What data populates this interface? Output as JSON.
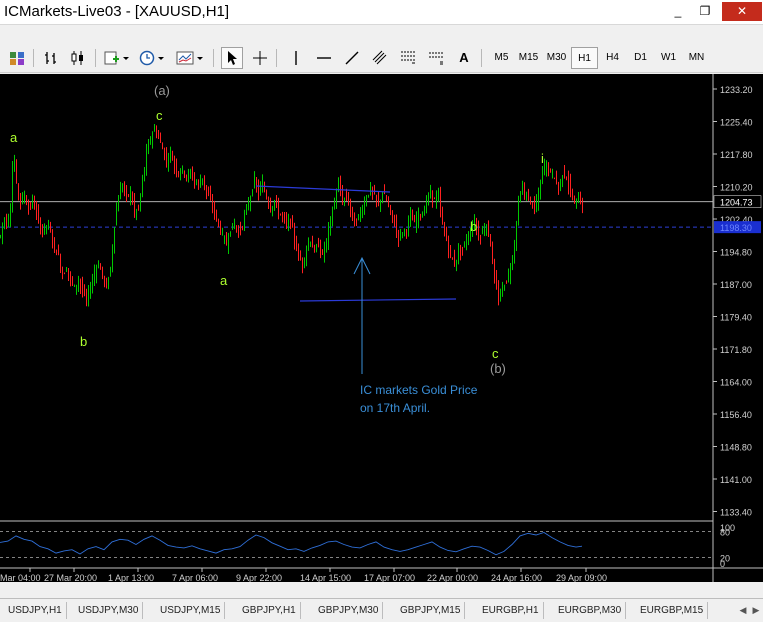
{
  "window": {
    "title": "ICMarkets-Live03 - [XAUUSD,H1]",
    "minimize": "_",
    "restore": "❐",
    "close": "✕"
  },
  "toolbar": {
    "timeframes": [
      "M5",
      "M15",
      "M30",
      "H1",
      "H4",
      "D1",
      "W1",
      "MN"
    ],
    "active_timeframe": "H1",
    "text_tool": "A"
  },
  "chart": {
    "background": "#000000",
    "bull_color": "#00c800",
    "bear_color": "#ff2020",
    "wave_label_color": "#adff2f",
    "major_label_color": "#9a9a9a",
    "channel_color": "#2b3bd8",
    "arrow_color": "#3a8fd8",
    "price_axis_labels": [
      "1233.20",
      "1225.40",
      "1217.80",
      "1210.20",
      "1202.40",
      "1194.80",
      "1187.00",
      "1179.40",
      "1171.80",
      "1164.00",
      "1156.40",
      "1148.80",
      "1141.00",
      "1133.40"
    ],
    "current_price_label": "1204.73",
    "bid_line_label": "1198.30",
    "date_labels": [
      "Mar 04:00",
      "27 Mar 20:00",
      "1 Apr 13:00",
      "7 Apr 06:00",
      "9 Apr 22:00",
      "14 Apr 15:00",
      "17 Apr 07:00",
      "22 Apr 00:00",
      "24 Apr 16:00",
      "29 Apr 09:00"
    ],
    "wave_labels": {
      "a1": "a",
      "b1": "b",
      "c1": "c",
      "a2": "a",
      "b2": "b",
      "c2": "c",
      "i": "i",
      "major_a": "(a)",
      "major_b": "(b)"
    },
    "annotation": {
      "line1": "IC markets Gold Price",
      "line2": "on 17th April."
    },
    "chart_data": {
      "type": "candlestick",
      "symbol": "XAUUSD",
      "timeframe": "H1",
      "ylim": [
        1133.4,
        1233.2
      ],
      "current_price": 1204.73,
      "bid_price": 1198.3,
      "path": [
        [
          0,
          1196
        ],
        [
          3,
          1201
        ],
        [
          6,
          1199
        ],
        [
          10,
          1203
        ],
        [
          13,
          1218
        ],
        [
          16,
          1209
        ],
        [
          20,
          1205
        ],
        [
          24,
          1206
        ],
        [
          28,
          1203
        ],
        [
          32,
          1205
        ],
        [
          37,
          1201
        ],
        [
          41,
          1197
        ],
        [
          45,
          1199
        ],
        [
          49,
          1198
        ],
        [
          54,
          1193
        ],
        [
          58,
          1191
        ],
        [
          62,
          1186
        ],
        [
          66,
          1188
        ],
        [
          70,
          1185
        ],
        [
          74,
          1183
        ],
        [
          78,
          1185
        ],
        [
          82,
          1182
        ],
        [
          86,
          1180
        ],
        [
          90,
          1183
        ],
        [
          94,
          1187
        ],
        [
          98,
          1189
        ],
        [
          102,
          1186
        ],
        [
          106,
          1183
        ],
        [
          110,
          1188
        ],
        [
          114,
          1199
        ],
        [
          118,
          1206
        ],
        [
          122,
          1209
        ],
        [
          126,
          1206
        ],
        [
          130,
          1207
        ],
        [
          134,
          1202
        ],
        [
          138,
          1203
        ],
        [
          142,
          1210
        ],
        [
          146,
          1217
        ],
        [
          150,
          1221
        ],
        [
          154,
          1223
        ],
        [
          158,
          1221
        ],
        [
          162,
          1218
        ],
        [
          166,
          1215
        ],
        [
          170,
          1217
        ],
        [
          174,
          1214
        ],
        [
          178,
          1212
        ],
        [
          182,
          1213
        ],
        [
          186,
          1211
        ],
        [
          190,
          1212
        ],
        [
          194,
          1210
        ],
        [
          198,
          1209
        ],
        [
          202,
          1211
        ],
        [
          206,
          1207
        ],
        [
          210,
          1205
        ],
        [
          214,
          1202
        ],
        [
          218,
          1199
        ],
        [
          222,
          1196
        ],
        [
          226,
          1194
        ],
        [
          230,
          1198
        ],
        [
          234,
          1199
        ],
        [
          238,
          1197
        ],
        [
          242,
          1199
        ],
        [
          246,
          1203
        ],
        [
          250,
          1206
        ],
        [
          254,
          1210
        ],
        [
          258,
          1207
        ],
        [
          262,
          1209
        ],
        [
          266,
          1206
        ],
        [
          270,
          1203
        ],
        [
          274,
          1205
        ],
        [
          278,
          1202
        ],
        [
          282,
          1201
        ],
        [
          286,
          1199
        ],
        [
          290,
          1200
        ],
        [
          294,
          1195
        ],
        [
          298,
          1191
        ],
        [
          302,
          1189
        ],
        [
          306,
          1193
        ],
        [
          310,
          1195
        ],
        [
          314,
          1192
        ],
        [
          318,
          1194
        ],
        [
          322,
          1191
        ],
        [
          326,
          1195
        ],
        [
          330,
          1200
        ],
        [
          334,
          1205
        ],
        [
          338,
          1209
        ],
        [
          342,
          1205
        ],
        [
          346,
          1206
        ],
        [
          350,
          1203
        ],
        [
          354,
          1199
        ],
        [
          358,
          1201
        ],
        [
          362,
          1203
        ],
        [
          366,
          1206
        ],
        [
          370,
          1208
        ],
        [
          374,
          1206
        ],
        [
          378,
          1204
        ],
        [
          382,
          1207
        ],
        [
          386,
          1205
        ],
        [
          390,
          1202
        ],
        [
          394,
          1199
        ],
        [
          398,
          1196
        ],
        [
          402,
          1197
        ],
        [
          406,
          1198
        ],
        [
          410,
          1201
        ],
        [
          414,
          1199
        ],
        [
          418,
          1202
        ],
        [
          422,
          1201
        ],
        [
          426,
          1205
        ],
        [
          430,
          1207
        ],
        [
          434,
          1205
        ],
        [
          438,
          1206
        ],
        [
          442,
          1199
        ],
        [
          446,
          1195
        ],
        [
          450,
          1191
        ],
        [
          454,
          1189
        ],
        [
          458,
          1192
        ],
        [
          462,
          1193
        ],
        [
          466,
          1195
        ],
        [
          470,
          1197
        ],
        [
          474,
          1200
        ],
        [
          478,
          1196
        ],
        [
          482,
          1197
        ],
        [
          486,
          1199
        ],
        [
          490,
          1194
        ],
        [
          494,
          1185
        ],
        [
          498,
          1180
        ],
        [
          502,
          1183
        ],
        [
          506,
          1185
        ],
        [
          510,
          1188
        ],
        [
          514,
          1194
        ],
        [
          518,
          1205
        ],
        [
          522,
          1208
        ],
        [
          526,
          1206
        ],
        [
          530,
          1205
        ],
        [
          534,
          1203
        ],
        [
          538,
          1206
        ],
        [
          542,
          1213
        ],
        [
          546,
          1214
        ],
        [
          550,
          1212
        ],
        [
          554,
          1211
        ],
        [
          558,
          1208
        ],
        [
          562,
          1212
        ],
        [
          566,
          1211
        ],
        [
          570,
          1207
        ],
        [
          574,
          1204
        ],
        [
          578,
          1206
        ],
        [
          582,
          1203
        ]
      ],
      "indicator": {
        "levels": [
          20,
          80
        ],
        "axis_labels": [
          "100",
          "80",
          "20",
          "0"
        ],
        "path": [
          [
            0,
            55
          ],
          [
            8,
            58
          ],
          [
            16,
            70
          ],
          [
            24,
            62
          ],
          [
            32,
            58
          ],
          [
            40,
            45
          ],
          [
            48,
            40
          ],
          [
            56,
            30
          ],
          [
            64,
            35
          ],
          [
            72,
            38
          ],
          [
            80,
            28
          ],
          [
            88,
            40
          ],
          [
            96,
            45
          ],
          [
            104,
            38
          ],
          [
            112,
            56
          ],
          [
            120,
            62
          ],
          [
            128,
            60
          ],
          [
            136,
            50
          ],
          [
            144,
            62
          ],
          [
            152,
            70
          ],
          [
            160,
            60
          ],
          [
            168,
            48
          ],
          [
            176,
            44
          ],
          [
            184,
            42
          ],
          [
            192,
            47
          ],
          [
            200,
            40
          ],
          [
            208,
            35
          ],
          [
            216,
            30
          ],
          [
            224,
            38
          ],
          [
            232,
            40
          ],
          [
            240,
            45
          ],
          [
            248,
            60
          ],
          [
            256,
            72
          ],
          [
            264,
            66
          ],
          [
            272,
            54
          ],
          [
            280,
            46
          ],
          [
            288,
            38
          ],
          [
            296,
            40
          ],
          [
            304,
            34
          ],
          [
            312,
            42
          ],
          [
            320,
            48
          ],
          [
            328,
            56
          ],
          [
            336,
            58
          ],
          [
            344,
            50
          ],
          [
            352,
            44
          ],
          [
            360,
            42
          ],
          [
            368,
            50
          ],
          [
            376,
            56
          ],
          [
            384,
            44
          ],
          [
            392,
            38
          ],
          [
            400,
            34
          ],
          [
            408,
            38
          ],
          [
            416,
            44
          ],
          [
            424,
            50
          ],
          [
            432,
            56
          ],
          [
            440,
            44
          ],
          [
            448,
            36
          ],
          [
            456,
            33
          ],
          [
            464,
            40
          ],
          [
            472,
            46
          ],
          [
            480,
            44
          ],
          [
            488,
            36
          ],
          [
            496,
            26
          ],
          [
            504,
            34
          ],
          [
            512,
            50
          ],
          [
            520,
            70
          ],
          [
            528,
            76
          ],
          [
            536,
            72
          ],
          [
            544,
            78
          ],
          [
            552,
            66
          ],
          [
            560,
            56
          ],
          [
            568,
            48
          ],
          [
            576,
            44
          ],
          [
            582,
            46
          ]
        ]
      }
    }
  },
  "tabs": [
    "USDJPY,H1",
    "USDJPY,M30",
    "USDJPY,M15",
    "GBPJPY,H1",
    "GBPJPY,M30",
    "GBPJPY,M15",
    "EURGBP,H1",
    "EURGBP,M30",
    "EURGBP,M15"
  ],
  "tab_scroll": {
    "left": "◀",
    "right": "▶"
  }
}
